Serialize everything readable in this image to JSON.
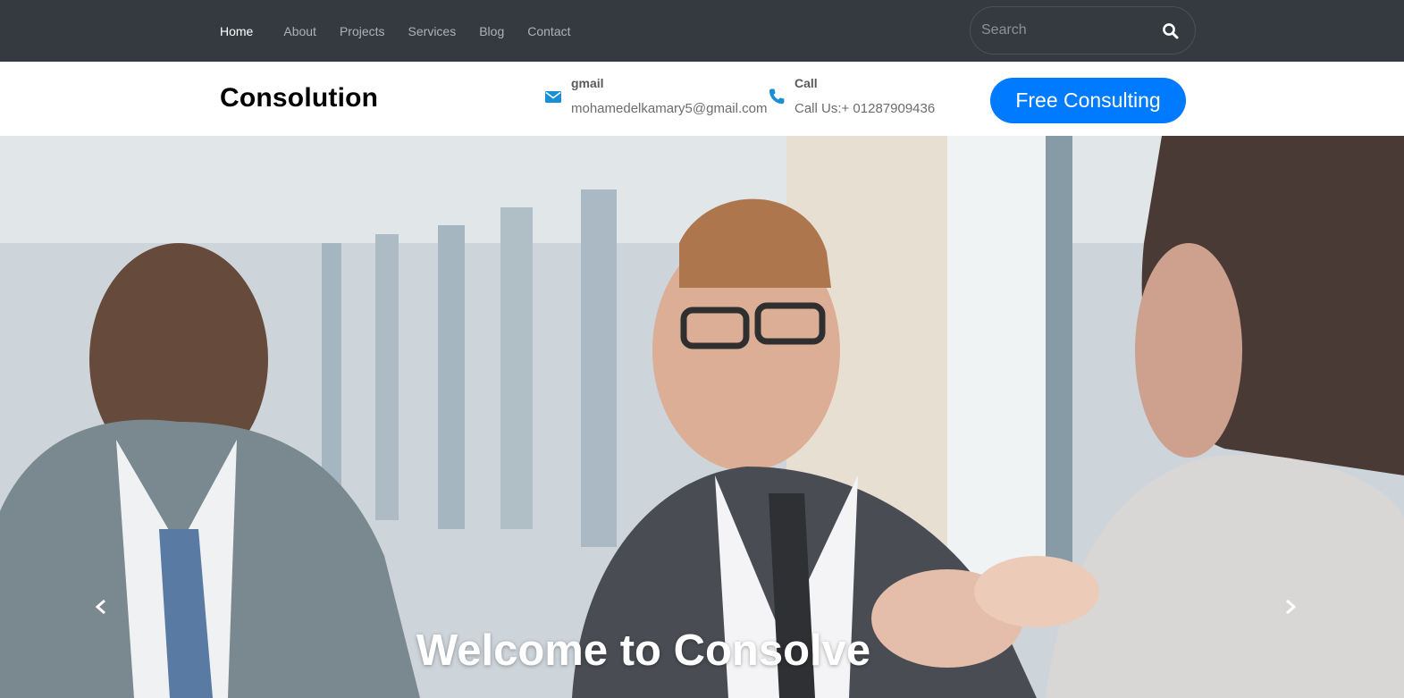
{
  "nav": {
    "items": [
      {
        "label": "Home",
        "active": true
      },
      {
        "label": "About"
      },
      {
        "label": "Projects"
      },
      {
        "label": "Services"
      },
      {
        "label": "Blog"
      },
      {
        "label": "Contact"
      }
    ]
  },
  "search": {
    "placeholder": "Search",
    "icon": "search-icon"
  },
  "header": {
    "brand": "Consolution",
    "email": {
      "title": "gmail",
      "value": "mohamedelkamary5@gmail.com",
      "icon": "envelope-icon"
    },
    "phone": {
      "title": "Call",
      "value": "Call Us:+ 01287909436",
      "icon": "phone-icon"
    },
    "cta_label": "Free Consulting"
  },
  "hero": {
    "title": "Welcome to Consolve",
    "prev_icon": "chevron-left-icon",
    "next_icon": "chevron-right-icon"
  },
  "colors": {
    "topbar": "#343a40",
    "accent": "#007bff",
    "icon_blue": "#1a8fd6"
  }
}
